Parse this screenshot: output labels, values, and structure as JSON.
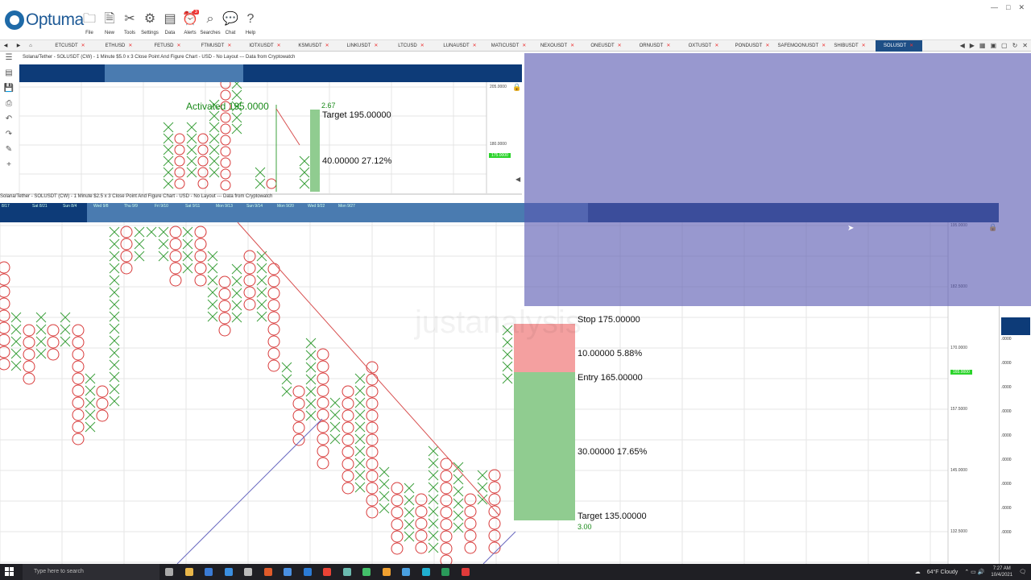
{
  "app": {
    "logo_text": "Optuma"
  },
  "toolbar": [
    {
      "label": "File",
      "icon": "folder-icon",
      "glyph": "🗀"
    },
    {
      "label": "New",
      "icon": "new-doc-icon",
      "glyph": "🗎"
    },
    {
      "label": "Tools",
      "icon": "tools-icon",
      "glyph": "✂"
    },
    {
      "label": "Settings",
      "icon": "gear-icon",
      "glyph": "⚙"
    },
    {
      "label": "Data",
      "icon": "data-icon",
      "glyph": "▤"
    },
    {
      "label": "Alerts",
      "icon": "alarm-clock-icon",
      "glyph": "⏰"
    },
    {
      "label": "Searches",
      "icon": "search-icon",
      "glyph": "⌕"
    },
    {
      "label": "Chat",
      "icon": "chat-icon",
      "glyph": "💬"
    },
    {
      "label": "Help",
      "icon": "help-icon",
      "glyph": "?"
    }
  ],
  "alerts_badge": "3",
  "tabs": [
    "ETCUSDT",
    "ETHUSD",
    "FETUSD",
    "FTMUSDT",
    "IOTXUSDT",
    "KSMUSDT",
    "LINKUSDT",
    "LTCUSD",
    "LUNAUSDT",
    "MATICUSDT",
    "NEXOUSDT",
    "ONEUSDT",
    "ORNUSDT",
    "OXTUSDT",
    "PONDUSDT",
    "SAFEMOONUSDT",
    "SHIBUSDT",
    "SOLUSDT"
  ],
  "active_tab": "SOLUSDT",
  "chart1": {
    "title": "Solana/Tether - SOLUSDT (CW) - 1 Minute $5.0 x 3 Close Point And Figure Chart - USD - No Layout --- Data from Cryptowatch",
    "activated": "Activated 195.0000",
    "ratio": "2.67",
    "target": "Target  195.00000",
    "gain": "40.00000  27.12%",
    "axis": [
      "205.0000",
      "180.0000"
    ],
    "price_tag": "175.0000"
  },
  "chart2": {
    "title": "Solana/Tether - SOLUSDT (CW) - 1 Minute $2.5 x 3 Close Point And Figure Chart - USD - No Layout --- Data from Cryptowatch",
    "band_labels": [
      "8/17",
      "Sat 8/21",
      "Sun 8/4",
      "Wed 9/8",
      "Thu 9/9",
      "Fri 9/10",
      "Sat 9/11",
      "Mon 9/13",
      "Sun 9/14",
      "Mon 9/20",
      "Wed 9/22",
      "Mon 9/27"
    ],
    "stop": "Stop  175.00000",
    "risk": "10.00000  5.88%",
    "entry": "Entry  165.00000",
    "reward": "30.00000  17.65%",
    "target": "Target  135.00000",
    "ratio": "3.00",
    "axis": [
      "195.0000",
      "182.5000",
      "170.0000",
      "157.5000",
      "145.0000",
      "132.5000"
    ],
    "price_tag": "165.0000",
    "watermark": "justanalysis"
  },
  "right_axis": [
    ".0000",
    ".0000",
    ".0000",
    ".0000",
    ".0000",
    ".0000",
    ".0000",
    ".0000",
    ".0000"
  ],
  "taskbar": {
    "search_placeholder": "Type here to search",
    "weather": "64°F  Cloudy",
    "time": "7:27 AM",
    "date": "10/4/2021",
    "notification_count": "22"
  },
  "colors": {
    "band": "#0d3b78",
    "overlay": "#5858b2",
    "stop_zone": "#f4a0a0",
    "target_zone": "#90cc90",
    "x_mark": "#3da03d",
    "o_mark": "#d83a3a"
  }
}
